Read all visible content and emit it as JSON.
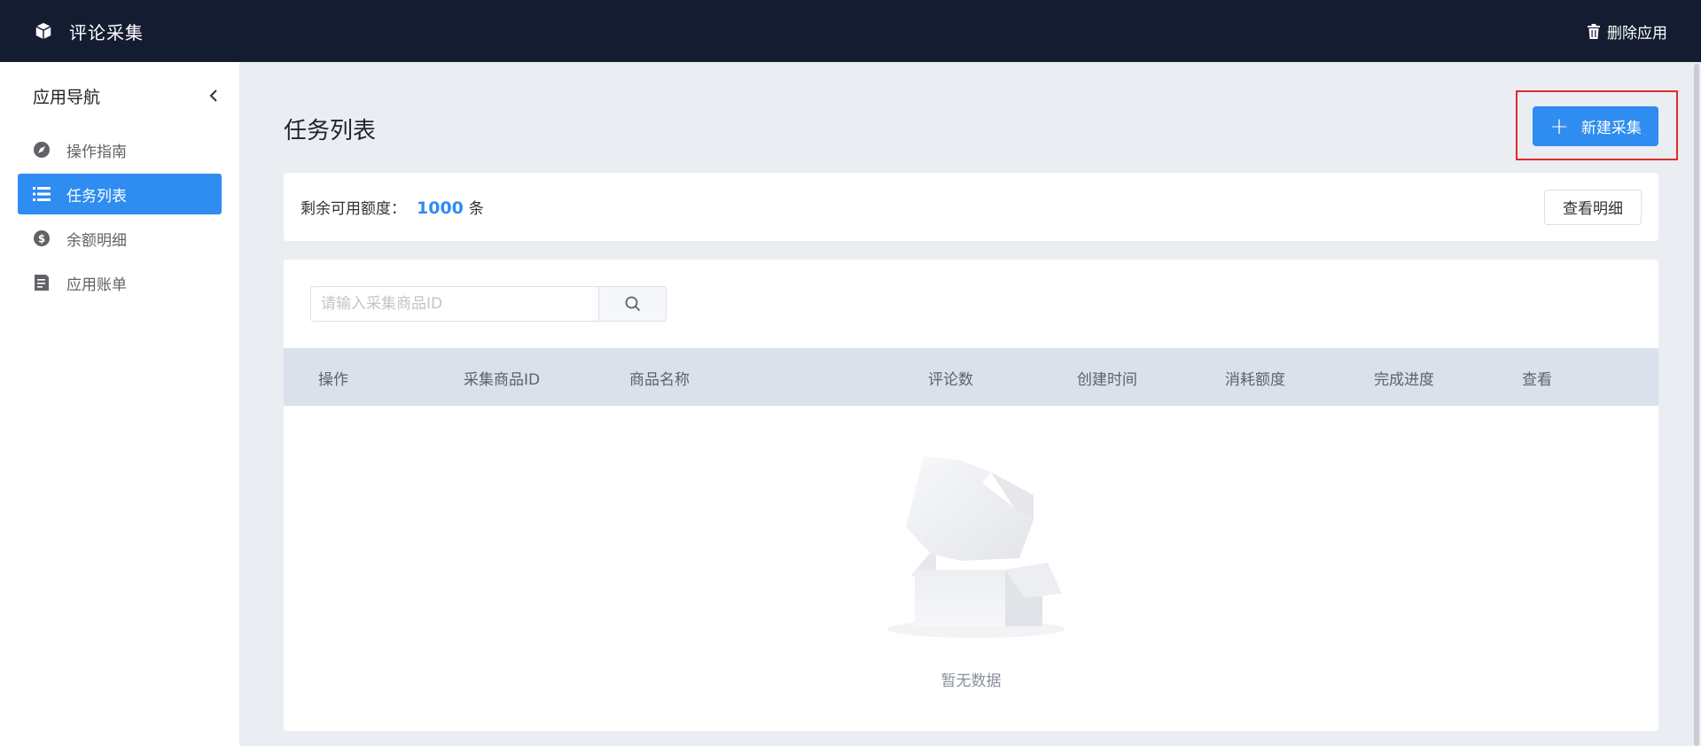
{
  "app": {
    "title": "评论采集",
    "delete_label": "删除应用"
  },
  "sidebar": {
    "heading": "应用导航",
    "items": [
      {
        "label": "操作指南",
        "icon": "compass-icon"
      },
      {
        "label": "任务列表",
        "icon": "list-icon",
        "active": true
      },
      {
        "label": "余额明细",
        "icon": "dollar-icon"
      },
      {
        "label": "应用账单",
        "icon": "document-icon"
      }
    ]
  },
  "main": {
    "page_title": "任务列表",
    "new_button_label": "新建采集",
    "quota": {
      "label": "剩余可用额度：",
      "value": "1000",
      "unit": "条",
      "detail_button": "查看明细"
    },
    "search": {
      "placeholder": "请输入采集商品ID",
      "value": ""
    },
    "table": {
      "columns": [
        "操作",
        "采集商品ID",
        "商品名称",
        "评论数",
        "创建时间",
        "消耗额度",
        "完成进度",
        "查看"
      ],
      "rows": [],
      "empty_text": "暂无数据"
    }
  },
  "colors": {
    "topbar": "#141c32",
    "accent": "#2f8cf0",
    "highlight": "#e02b2b"
  }
}
